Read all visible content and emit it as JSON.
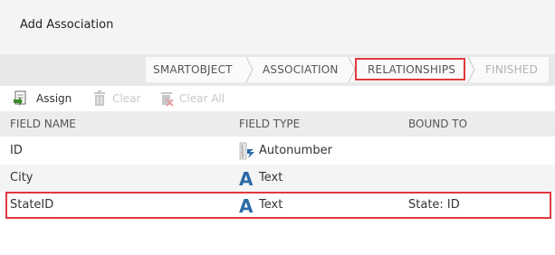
{
  "dialog": {
    "title": "Add Association"
  },
  "wizard": {
    "steps": [
      {
        "label": "SMARTOBJECT",
        "state": "done"
      },
      {
        "label": "ASSOCIATION",
        "state": "done"
      },
      {
        "label": "RELATIONSHIPS",
        "state": "active"
      },
      {
        "label": "FINISHED",
        "state": "pending"
      }
    ]
  },
  "toolbar": {
    "assign_label": "Assign",
    "clear_label": "Clear",
    "clear_all_label": "Clear All"
  },
  "table": {
    "columns": [
      "FIELD NAME",
      "FIELD TYPE",
      "BOUND TO"
    ],
    "rows": [
      {
        "name": "ID",
        "type": "Autonumber",
        "type_icon": "autonumber-icon",
        "bound_to": ""
      },
      {
        "name": "City",
        "type": "Text",
        "type_icon": "text-type-icon",
        "bound_to": ""
      },
      {
        "name": "StateID",
        "type": "Text",
        "type_icon": "text-type-icon",
        "bound_to": "State: ID"
      }
    ]
  },
  "colors": {
    "highlight": "#e0393e",
    "accent": "#2b6aa6"
  }
}
